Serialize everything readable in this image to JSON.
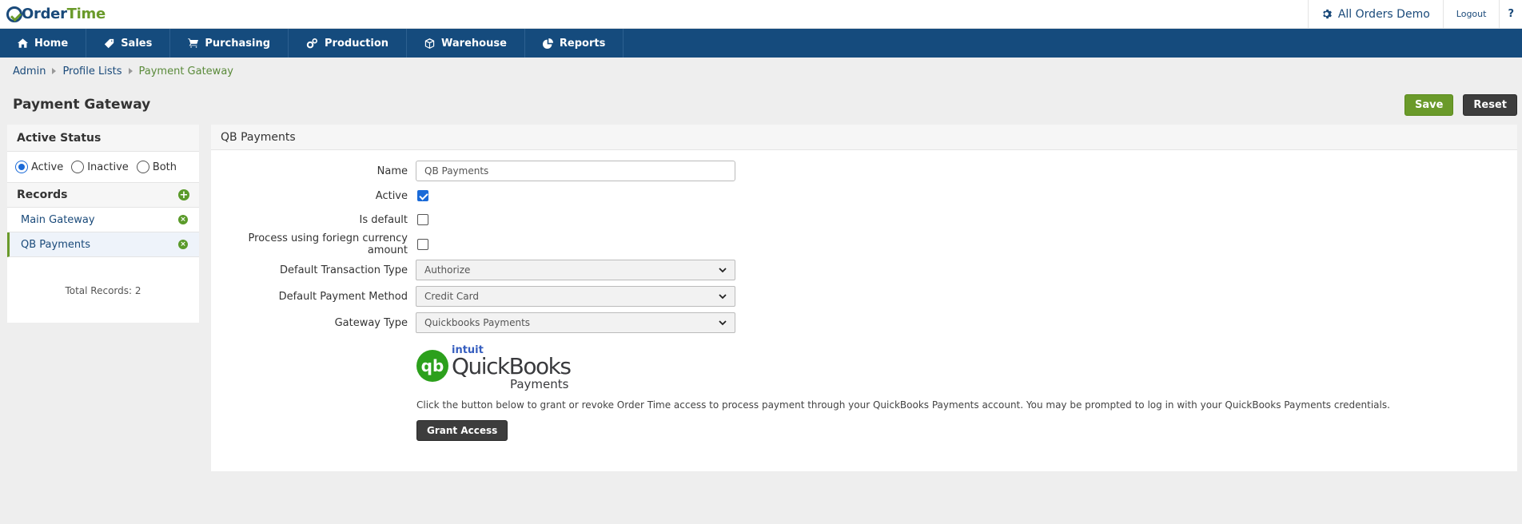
{
  "app": {
    "logo_part1": "Order",
    "logo_part2": "Time"
  },
  "topbar": {
    "company": "All Orders Demo",
    "logout": "Logout",
    "help": "?"
  },
  "nav": [
    {
      "label": "Home",
      "icon": "home-icon"
    },
    {
      "label": "Sales",
      "icon": "tag-icon"
    },
    {
      "label": "Purchasing",
      "icon": "cart-icon"
    },
    {
      "label": "Production",
      "icon": "gears-icon"
    },
    {
      "label": "Warehouse",
      "icon": "box-icon"
    },
    {
      "label": "Reports",
      "icon": "pie-chart-icon"
    }
  ],
  "breadcrumb": [
    "Admin",
    "Profile Lists",
    "Payment Gateway"
  ],
  "page": {
    "title": "Payment Gateway",
    "save": "Save",
    "reset": "Reset"
  },
  "sidebar": {
    "status_title": "Active Status",
    "status_options": [
      "Active",
      "Inactive",
      "Both"
    ],
    "records_title": "Records",
    "records": [
      "Main Gateway",
      "QB Payments"
    ],
    "total": "Total Records: 2"
  },
  "main": {
    "title": "QB Payments",
    "labels": {
      "name": "Name",
      "active": "Active",
      "is_default": "Is default",
      "foreign": "Process using foriegn currency amount",
      "txn_type": "Default Transaction Type",
      "pay_method": "Default Payment Method",
      "gateway_type": "Gateway Type"
    },
    "values": {
      "name": "QB Payments",
      "txn_type": "Authorize",
      "pay_method": "Credit Card",
      "gateway_type": "Quickbooks Payments"
    },
    "logo": {
      "badge": "qb",
      "intuit": "intuit",
      "brand": "QuickBooks",
      "sub": "Payments"
    },
    "description": "Click the button below to grant or revoke Order Time access to process payment through your QuickBooks Payments account. You may be prompted to log in with your QuickBooks Payments credentials.",
    "grant": "Grant Access"
  },
  "colors": {
    "nav": "#154b7d",
    "accent_green": "#6a9a2a",
    "link": "#1a4a7a"
  }
}
